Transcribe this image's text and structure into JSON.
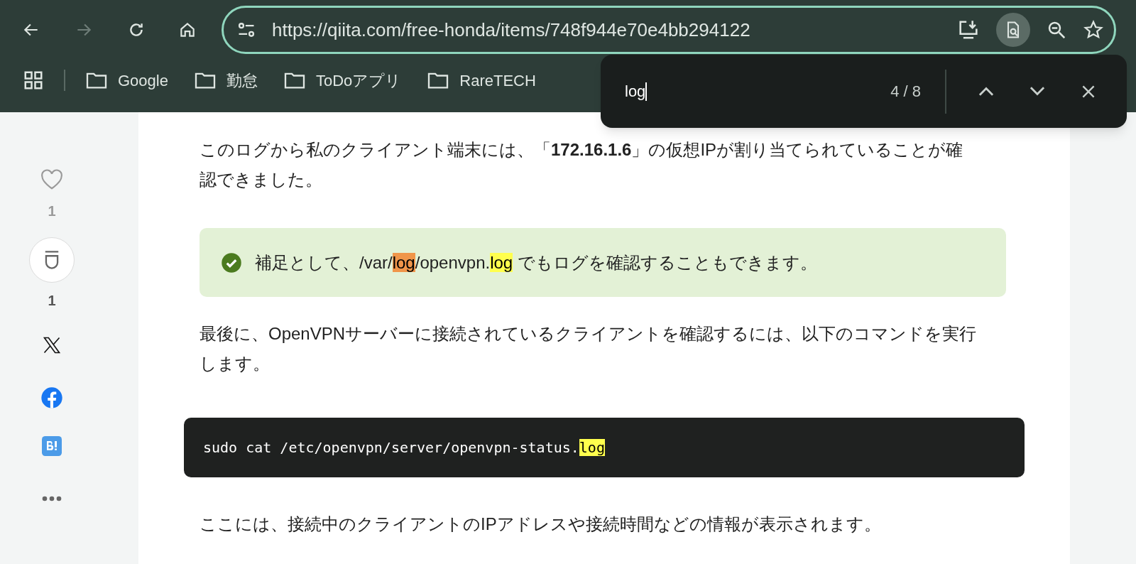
{
  "toolbar": {
    "back": {
      "disabled": false
    },
    "forward": {
      "disabled": true
    },
    "url": "https://qiita.com/free-honda/items/748f944e70e4bb294122",
    "find_in_page_active": true
  },
  "bookmarks": [
    {
      "label": "Google"
    },
    {
      "label": "勤怠"
    },
    {
      "label": "ToDoアプリ"
    },
    {
      "label": "RareTECH"
    }
  ],
  "find_bar": {
    "query": "log",
    "count": "4 / 8"
  },
  "sidebar": {
    "like_count": "1",
    "stock_count": "1"
  },
  "article": {
    "paragraph_1": "このログから私のクライアント端末には、「**172.16.1.6**」の仮想IPが割り当てられていることが確認できました。",
    "note": [
      {
        "text": "補足として、/var/",
        "highlighted": false,
        "current": false
      },
      {
        "text": "log",
        "highlighted": true,
        "current": true
      },
      {
        "text": "/openvpn.",
        "highlighted": false,
        "current": false
      },
      {
        "text": "log",
        "highlighted": true,
        "current": false
      },
      {
        "text": " でもログを確認することもできます。",
        "highlighted": false,
        "current": false
      }
    ],
    "paragraph_2": "最後に、OpenVPNサーバーに接続されているクライアントを確認するには、以下のコマンドを実行します。",
    "code": [
      {
        "text": "sudo cat /etc/openvpn/server/openvpn-status.",
        "highlighted": false,
        "current": false
      },
      {
        "text": "log",
        "highlighted": true,
        "current": false
      }
    ],
    "paragraph_3": "ここには、接続中のクライアントのIPアドレスや接続時間などの情報が表示されます。"
  }
}
